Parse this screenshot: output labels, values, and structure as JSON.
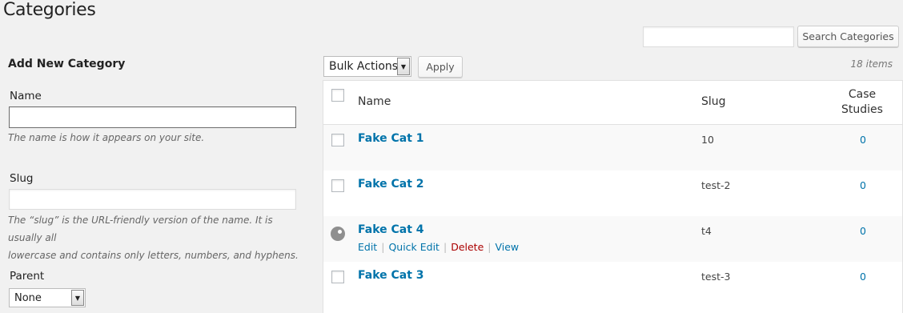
{
  "page": {
    "title": "Categories"
  },
  "search": {
    "placeholder": "",
    "value": "",
    "button_label": "Search Categories"
  },
  "form": {
    "heading": "Add New Category",
    "name_label": "Name",
    "name_help": "The name is how it appears on your site.",
    "slug_label": "Slug",
    "slug_help_line1": "The “slug” is the URL-friendly version of the name. It is usually all",
    "slug_help_line2": "lowercase and contains only letters, numbers, and hyphens.",
    "parent_label": "Parent",
    "parent_value": "None"
  },
  "bulk": {
    "selected": "Bulk Actions",
    "apply_label": "Apply",
    "items_count": "18 items"
  },
  "table": {
    "headers": {
      "name": "Name",
      "slug": "Slug",
      "case_line1": "Case",
      "case_line2": "Studies"
    },
    "rows": [
      {
        "name": "Fake Cat 1",
        "slug": "10",
        "count": "0"
      },
      {
        "name": "Fake Cat 2",
        "slug": "test-2",
        "count": "0"
      },
      {
        "name": "Fake Cat 4",
        "slug": "t4",
        "count": "0",
        "actions": {
          "edit": "Edit",
          "quick_edit": "Quick Edit",
          "delete": "Delete",
          "view": "View"
        }
      },
      {
        "name": "Fake Cat 3",
        "slug": "test-3",
        "count": "0"
      }
    ]
  },
  "colors": {
    "link": "#0073aa",
    "delete": "#aa0000",
    "background": "#f1f1f1"
  }
}
